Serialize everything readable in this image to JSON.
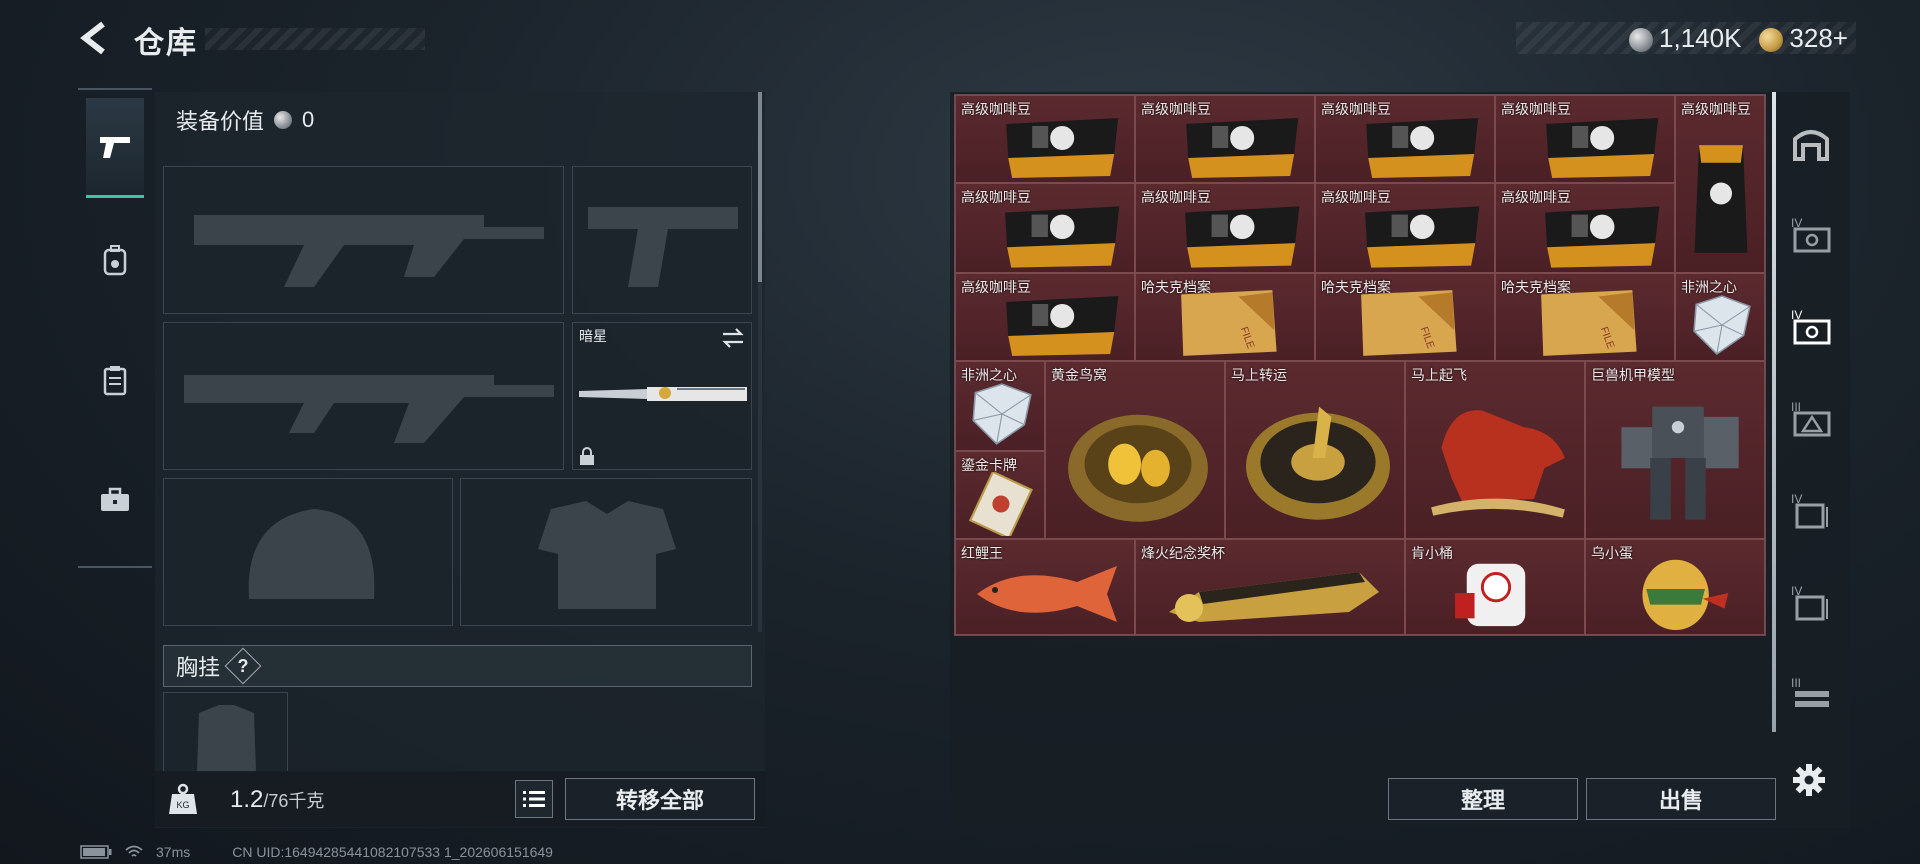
{
  "header": {
    "title": "仓库",
    "currency": [
      {
        "icon": "silver-coin-icon",
        "value": "1,140K"
      },
      {
        "icon": "gold-coin-icon",
        "value": "328+"
      }
    ]
  },
  "left_tabs": [
    {
      "icon": "pistol-icon",
      "active": true
    },
    {
      "icon": "backpack-icon",
      "active": false
    },
    {
      "icon": "vest-icon",
      "active": false
    },
    {
      "icon": "toolbox-icon",
      "active": false
    }
  ],
  "equipment": {
    "value_label": "装备价值",
    "value": "0",
    "melee_name": "暗星",
    "chest_label": "胸挂",
    "chest_help": "?"
  },
  "bottom": {
    "weight_current": "1.2",
    "weight_max": "/76千克",
    "transfer_all": "转移全部",
    "sort": "整理",
    "sell": "出售"
  },
  "storage_items": [
    {
      "name": "高级咖啡豆",
      "kind": "coffee"
    },
    {
      "name": "高级咖啡豆",
      "kind": "coffee"
    },
    {
      "name": "高级咖啡豆",
      "kind": "coffee"
    },
    {
      "name": "高级咖啡豆",
      "kind": "coffee"
    },
    {
      "name": "高级咖啡豆",
      "kind": "coffee-bag"
    },
    {
      "name": "高级咖啡豆",
      "kind": "coffee"
    },
    {
      "name": "高级咖啡豆",
      "kind": "coffee"
    },
    {
      "name": "高级咖啡豆",
      "kind": "coffee"
    },
    {
      "name": "高级咖啡豆",
      "kind": "coffee"
    },
    {
      "name": "高级咖啡豆",
      "kind": "coffee"
    },
    {
      "name": "哈夫克档案",
      "kind": "file"
    },
    {
      "name": "哈夫克档案",
      "kind": "file"
    },
    {
      "name": "哈夫克档案",
      "kind": "file"
    },
    {
      "name": "非洲之心",
      "kind": "diamond"
    },
    {
      "name": "非洲之心",
      "kind": "diamond"
    },
    {
      "name": "黄金鸟窝",
      "kind": "nest"
    },
    {
      "name": "马上转运",
      "kind": "wheel"
    },
    {
      "name": "马上起飞",
      "kind": "horse"
    },
    {
      "name": "巨兽机甲模型",
      "kind": "mech"
    },
    {
      "name": "鎏金卡牌",
      "kind": "card"
    },
    {
      "name": "红鲤王",
      "kind": "fish"
    },
    {
      "name": "烽火纪念奖杯",
      "kind": "trophy"
    },
    {
      "name": "肯小桶",
      "kind": "bucket"
    },
    {
      "name": "乌小蛋",
      "kind": "egg"
    }
  ],
  "right_rail": [
    {
      "icon": "warehouse-icon",
      "active": false
    },
    {
      "icon": "storage-iv-icon",
      "active": false
    },
    {
      "icon": "storage-iv-selected-icon",
      "active": true
    },
    {
      "icon": "storage-iii-icon",
      "active": false
    },
    {
      "icon": "storage-iv-file-icon",
      "active": false
    },
    {
      "icon": "storage-iv-file2-icon",
      "active": false
    },
    {
      "icon": "storage-iii-rack-icon",
      "active": false
    },
    {
      "icon": "settings-gear-icon",
      "active": false
    }
  ],
  "status": {
    "ping": "37ms",
    "uid": "CN UID:16494285441082107533 1_202606151649"
  }
}
